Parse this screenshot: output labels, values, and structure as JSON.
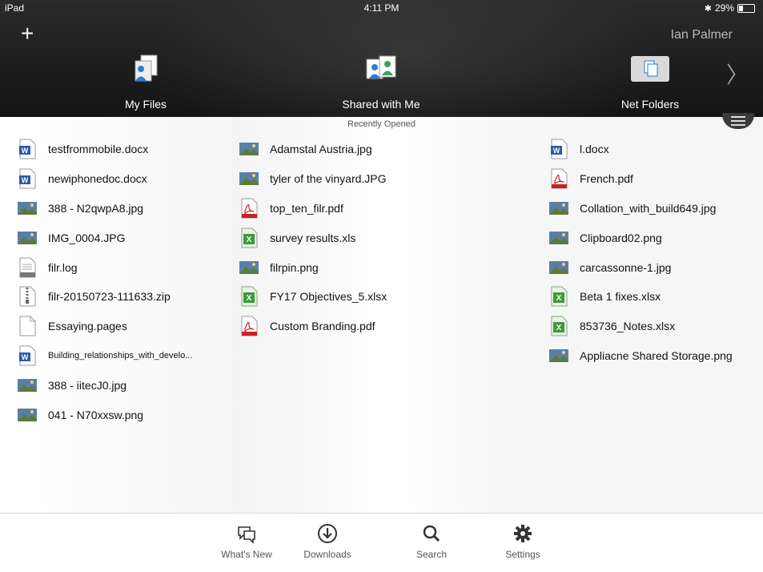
{
  "status": {
    "device": "iPad",
    "time": "4:11 PM",
    "battery": "29%"
  },
  "header": {
    "user": "Ian Palmer",
    "tabs": [
      "My Files",
      "Shared with Me",
      "Net Folders"
    ]
  },
  "section_title": "Recently Opened",
  "col1": [
    {
      "name": "testfrommobile.docx",
      "icon": "word-doc-icon"
    },
    {
      "name": "newiphonedoc.docx",
      "icon": "word-doc-icon"
    },
    {
      "name": "388 - N2qwpA8.jpg",
      "icon": "image-thumbnail-icon"
    },
    {
      "name": "IMG_0004.JPG",
      "icon": "image-thumbnail-icon"
    },
    {
      "name": "filr.log",
      "icon": "text-file-icon"
    },
    {
      "name": "filr-20150723-111633.zip",
      "icon": "zip-file-icon"
    },
    {
      "name": "Essaying.pages",
      "icon": "blank-file-icon"
    },
    {
      "name": "Building_relationships_with_develo...",
      "icon": "word-doc-icon"
    },
    {
      "name": "388 - iitecJ0.jpg",
      "icon": "image-thumbnail-icon"
    },
    {
      "name": "041 - N70xxsw.png",
      "icon": "image-thumbnail-icon"
    }
  ],
  "col2": [
    {
      "name": "Adamstal Austria.jpg",
      "icon": "image-thumbnail-icon"
    },
    {
      "name": "tyler of the vinyard.JPG",
      "icon": "image-thumbnail-icon"
    },
    {
      "name": "top_ten_filr.pdf",
      "icon": "pdf-file-icon"
    },
    {
      "name": "survey results.xls",
      "icon": "excel-file-icon"
    },
    {
      "name": "filrpin.png",
      "icon": "image-thumbnail-icon"
    },
    {
      "name": "FY17 Objectives_5.xlsx",
      "icon": "excel-file-icon"
    },
    {
      "name": "Custom Branding.pdf",
      "icon": "pdf-file-icon"
    }
  ],
  "col3": [
    {
      "name": "l.docx",
      "icon": "word-doc-icon"
    },
    {
      "name": "French.pdf",
      "icon": "pdf-file-icon"
    },
    {
      "name": "Collation_with_build649.jpg",
      "icon": "image-thumbnail-icon"
    },
    {
      "name": "Clipboard02.png",
      "icon": "image-thumbnail-icon"
    },
    {
      "name": "carcassonne-1.jpg",
      "icon": "image-thumbnail-icon"
    },
    {
      "name": "Beta 1 fixes.xlsx",
      "icon": "excel-file-icon"
    },
    {
      "name": "853736_Notes.xlsx",
      "icon": "excel-file-icon"
    },
    {
      "name": "Appliacne Shared Storage.png",
      "icon": "image-thumbnail-icon"
    }
  ],
  "tabbar": [
    "What's New",
    "Downloads",
    "Search",
    "Settings"
  ]
}
